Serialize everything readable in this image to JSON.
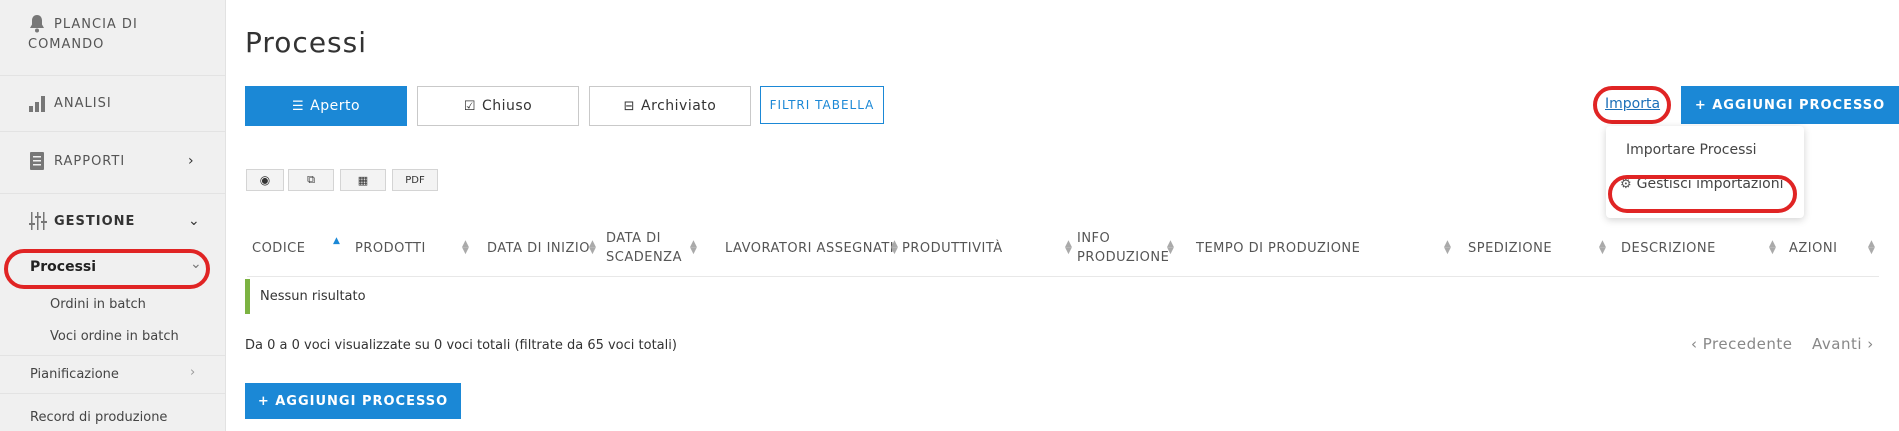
{
  "sidebar": {
    "dashboard_line1": "PLANCIA DI",
    "dashboard_line2": "COMANDO",
    "analytics": "ANALISI",
    "reports": "RAPPORTI",
    "management": "GESTIONE",
    "processes": "Processi",
    "batch_orders": "Ordini in batch",
    "batch_order_items": "Voci ordine in batch",
    "planning": "Pianificazione",
    "production_record": "Record di produzione"
  },
  "main": {
    "title": "Processi",
    "tabs": [
      "Aperto",
      "Chiuso",
      "Archiviato"
    ],
    "filters_label": "FILTRI TABELLA",
    "import_label": "Importa",
    "add_process_label": "+ AGGIUNGI PROCESSO",
    "dropdown": {
      "import_processes": "Importare Processi",
      "manage_imports": "Gestisci importazioni"
    },
    "tools": {
      "pdf": "PDF"
    },
    "columns": [
      "CODICE",
      "PRODOTTI",
      "DATA DI INIZIO",
      "DATA DI SCADENZA",
      "LAVORATORI ASSEGNATI",
      "PRODUTTIVITÀ",
      "INFO PRODUZIONE",
      "TEMPO DI PRODUZIONE",
      "SPEDIZIONE",
      "DESCRIZIONE",
      "AZIONI"
    ],
    "columns_split": {
      "due_date_1": "DATA DI",
      "due_date_2": "SCADENZA",
      "info_1": "INFO",
      "info_2": "PRODUZIONE"
    },
    "empty_message": "Nessun risultato",
    "table_info": "Da 0 a 0 voci visualizzate su 0 voci totali (filtrate da 65 voci totali)",
    "prev_label": "‹ Precedente",
    "next_label": "Avanti ›"
  },
  "colors": {
    "accent": "#1b88d6",
    "highlight": "#e02424",
    "empty_bar": "#7cb342"
  }
}
